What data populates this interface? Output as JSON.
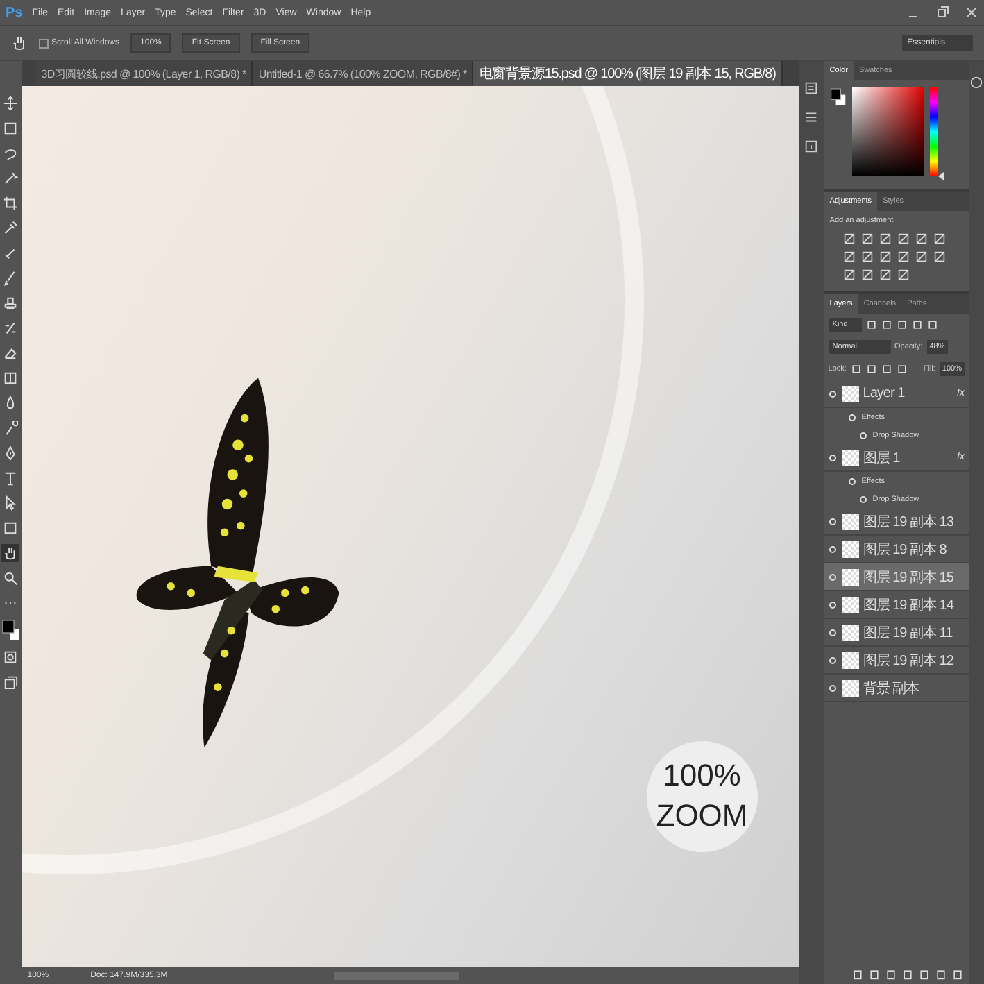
{
  "app": {
    "logo": "Ps"
  },
  "menu": [
    "File",
    "Edit",
    "Image",
    "Layer",
    "Type",
    "Select",
    "Filter",
    "3D",
    "View",
    "Window",
    "Help"
  ],
  "options_bar": {
    "scroll_all_windows": {
      "label": "Scroll All Windows",
      "checked": false
    },
    "buttons": [
      "100%",
      "Fit Screen",
      "Fill Screen"
    ],
    "workspace": "Essentials"
  },
  "tabs": [
    {
      "label": "3D习圆较线.psd @ 100% (Layer 1, RGB/8) *",
      "selected": false
    },
    {
      "label": "Untitled-1 @ 66.7% (100% ZOOM, RGB/8#) *",
      "selected": false
    },
    {
      "label": "电窗背景源15.psd @ 100% (图层 19 副本 15, RGB/8)",
      "selected": true
    }
  ],
  "tools": [
    {
      "kind": "move",
      "selected": false
    },
    {
      "kind": "marquee",
      "selected": false
    },
    {
      "kind": "lasso",
      "selected": false
    },
    {
      "kind": "wand",
      "selected": false
    },
    {
      "kind": "crop",
      "selected": false
    },
    {
      "kind": "eyedropper",
      "selected": false
    },
    {
      "kind": "heal",
      "selected": false
    },
    {
      "kind": "brush",
      "selected": false
    },
    {
      "kind": "stamp",
      "selected": false
    },
    {
      "kind": "history",
      "selected": false
    },
    {
      "kind": "eraser",
      "selected": false
    },
    {
      "kind": "gradient",
      "selected": false
    },
    {
      "kind": "blur",
      "selected": false
    },
    {
      "kind": "dodge",
      "selected": false
    },
    {
      "kind": "pen",
      "selected": false
    },
    {
      "kind": "type",
      "selected": false
    },
    {
      "kind": "path",
      "selected": false
    },
    {
      "kind": "shape",
      "selected": false
    },
    {
      "kind": "hand",
      "selected": true
    },
    {
      "kind": "zoom",
      "selected": false
    },
    {
      "kind": "more",
      "selected": false
    }
  ],
  "canvas": {
    "zoom_text": "100% ZOOM"
  },
  "status_bar": {
    "zoom": "100%",
    "doc": "Doc: 147.9M/335.3M"
  },
  "color_panel": {
    "hue_slider": {
      "level": 0
    },
    "tabs": [
      {
        "label": "Color",
        "selected": true
      },
      {
        "label": "Swatches",
        "selected": false
      }
    ]
  },
  "adjustments_panel": {
    "tabs": [
      {
        "label": "Adjustments",
        "selected": true
      },
      {
        "label": "Styles",
        "selected": false
      }
    ],
    "hint": "Add an adjustment"
  },
  "layers_panel": {
    "tabs": [
      {
        "label": "Layers",
        "selected": true
      },
      {
        "label": "Channels",
        "selected": false
      },
      {
        "label": "Paths",
        "selected": false
      }
    ],
    "filter": "Kind",
    "blend_mode": "Normal",
    "opacity_label": "Opacity:",
    "opacity": "48%",
    "lock_label": "Lock:",
    "fill_label": "Fill:",
    "fill": "100%",
    "layers": [
      {
        "name": "Layer 1",
        "visible": true,
        "selected": false,
        "fx": "fx",
        "effects": [
          {
            "name": "Effects",
            "visible": true
          },
          {
            "name": "Drop Shadow",
            "visible": true
          }
        ]
      },
      {
        "name": "图层 1",
        "visible": true,
        "selected": false,
        "fx": "fx",
        "effects": [
          {
            "name": "Effects",
            "visible": true
          },
          {
            "name": "Drop Shadow",
            "visible": true
          }
        ]
      },
      {
        "name": "图层 19 副本 13",
        "visible": true,
        "selected": false
      },
      {
        "name": "图层 19 副本 8",
        "visible": true,
        "selected": false
      },
      {
        "name": "图层 19 副本 15",
        "visible": true,
        "selected": true
      },
      {
        "name": "图层 19 副本 14",
        "visible": true,
        "selected": false
      },
      {
        "name": "图层 19 副本 11",
        "visible": true,
        "selected": false
      },
      {
        "name": "图层 19 副本 12",
        "visible": true,
        "selected": false
      },
      {
        "name": "背景 副本",
        "visible": true,
        "selected": false
      }
    ]
  }
}
